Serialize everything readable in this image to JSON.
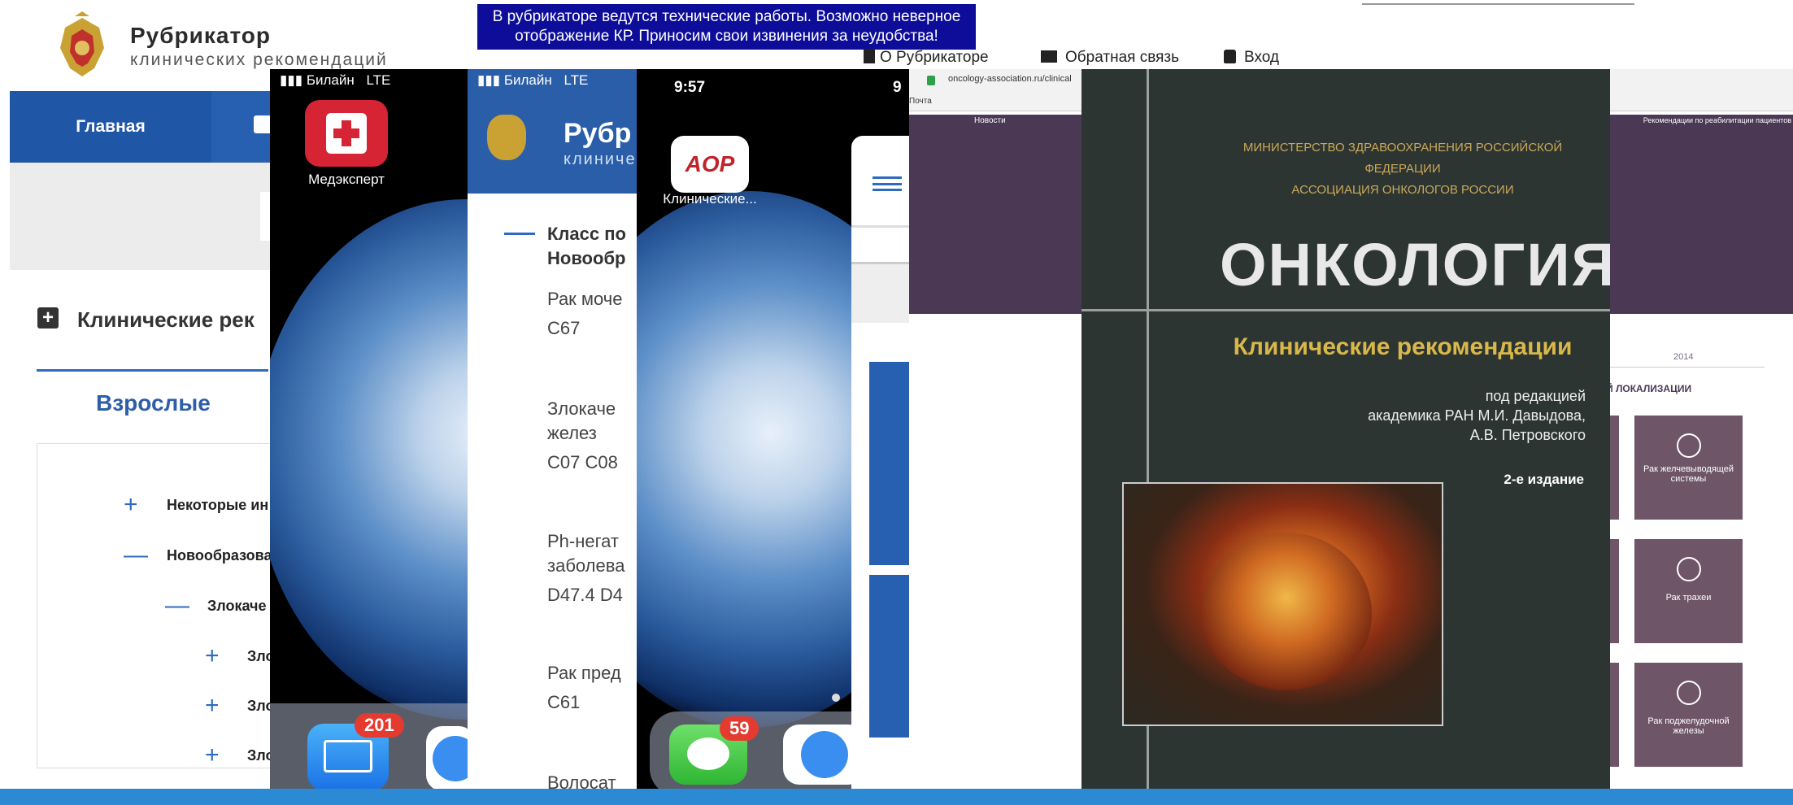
{
  "banner": {
    "text": "В рубрикаторе ведутся технические работы. Возможно неверное отображение КР. Приносим свои извинения за неудобства!"
  },
  "brand": {
    "title": "Рубрикатор",
    "subtitle": "клинических рекомендаций"
  },
  "toplinks": {
    "about": "О Рубрикаторе",
    "feedback": "Обратная связь",
    "login": "Вход"
  },
  "nav": {
    "home": "Главная"
  },
  "section": {
    "title": "Клинические рек",
    "tab": "Взрослые"
  },
  "tree": [
    {
      "sign": "+",
      "label": "Некоторые ин"
    },
    {
      "sign": "—",
      "label": "Новообразова"
    },
    {
      "sign": "—",
      "label": "Злокаче"
    },
    {
      "sign": "+",
      "label": "Зло"
    },
    {
      "sign": "+",
      "label": "Зло"
    },
    {
      "sign": "+",
      "label": "Зло"
    }
  ],
  "phone1": {
    "carrier": "Билайн",
    "network": "LTE",
    "app_label": "Медэксперт",
    "mail_badge": "201"
  },
  "panel2": {
    "carrier": "Билайн",
    "network": "LTE",
    "title": "Рубр",
    "subtitle": "клиниче",
    "class_line1": "Класс по",
    "class_line2": "Новообр",
    "items": [
      {
        "name": "Рак моче",
        "code": "C67"
      },
      {
        "name": "Злокаче",
        "name2": "желез",
        "code": "C07 C08"
      },
      {
        "name": "Ph-негат",
        "name2": "заболева",
        "code": "D47.4 D4"
      },
      {
        "name": "Рак пред",
        "code": "C61"
      },
      {
        "name": "Волосат",
        "code": ""
      }
    ]
  },
  "phone3": {
    "time": "9:57",
    "time2": "9",
    "app_label": "Клинические...",
    "app_logo": "AOP",
    "messages_badge": "59"
  },
  "oncoweb": {
    "url": "oncology-association.ru/clinical",
    "bookmark": "Почта",
    "nav_news": "Новости",
    "nav_right": "Рекомендации по реабилитации пациентов",
    "year": "2014",
    "loc": "Й ЛОКАЛИЗАЦИИ",
    "tiles": [
      "Рак желчевыводящей системы",
      "Рак трахеи",
      "Рак поджелудочной железы"
    ]
  },
  "book": {
    "ministry1": "МИНИСТЕРСТВО ЗДРАВООХРАНЕНИЯ РОССИЙСКОЙ ФЕДЕРАЦИИ",
    "ministry2": "АССОЦИАЦИЯ ОНКОЛОГОВ РОССИИ",
    "title": "ОНКОЛОГИЯ",
    "subtitle": "Клинические рекомендации",
    "editors1": "под редакцией",
    "editors2": "академика РАН М.И. Давыдова,",
    "editors3": "А.В. Петровского",
    "edition": "2-е издание"
  },
  "colors": {
    "banner": "#0d0d9a",
    "nav": "#2760b0",
    "accent": "#2e6bbf",
    "book_bg": "#2d3532",
    "book_title": "#e8e8e8",
    "book_sub": "#d9b84a",
    "tile": "#6e5668"
  }
}
